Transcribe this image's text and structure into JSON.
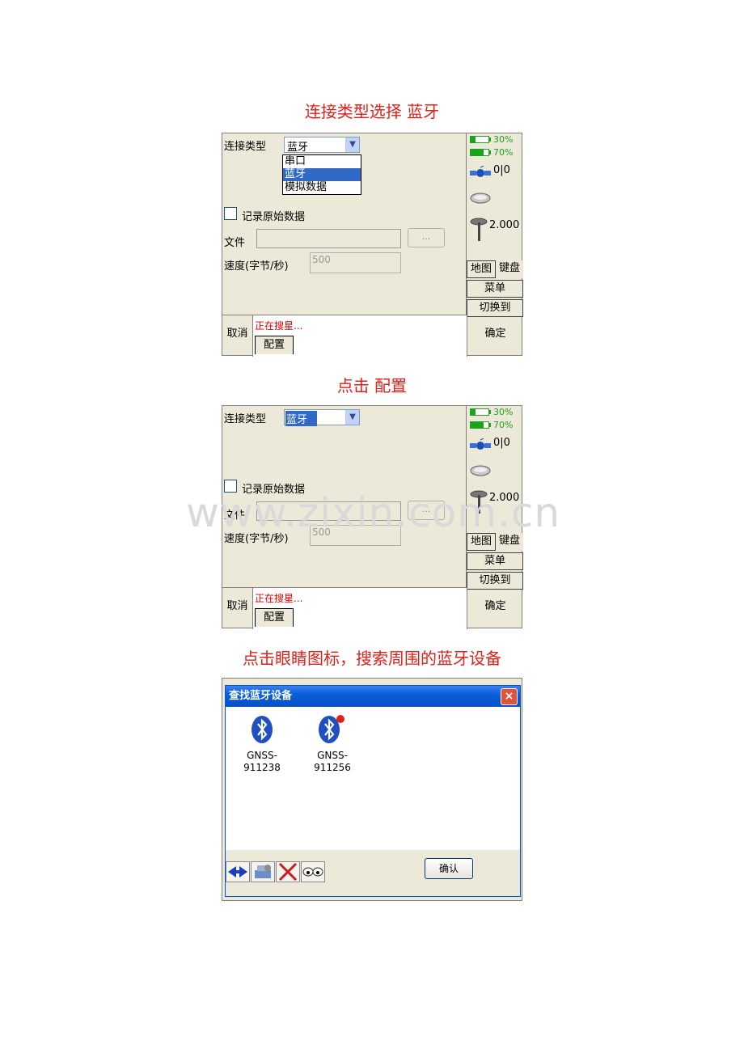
{
  "captions": [
    "连接类型选择    蓝牙",
    "点击  配置",
    "点击眼睛图标，搜索周围的蓝牙设备"
  ],
  "form": {
    "conn_type_label": "连接类型",
    "conn_type_value": "蓝牙",
    "conn_options": [
      "串口",
      "蓝牙",
      "模拟数据"
    ],
    "record_raw_label": "记录原始数据",
    "file_label": "文件",
    "browse_label": "...",
    "speed_label": "速度(字节/秒)",
    "speed_value": "500"
  },
  "status_panel": {
    "battery1": "30%",
    "battery1_level": 0.3,
    "battery2": "70%",
    "battery2_level": 0.7,
    "satellites": "0|0",
    "antenna_height": "2.000",
    "map_button": "地图",
    "keyboard_button": "键盘",
    "menu_button": "菜单",
    "switch_button": "切换到"
  },
  "bottom": {
    "cancel": "取消",
    "status_text": "正在搜星...",
    "config_tab": "配置",
    "ok": "确定"
  },
  "bt_dialog": {
    "title": "查找蓝牙设备",
    "close": "×",
    "devices": [
      {
        "name_line1": "GNSS-",
        "name_line2": "911238",
        "connected": false
      },
      {
        "name_line1": "GNSS-",
        "name_line2": "911256",
        "connected": true
      }
    ],
    "confirm": "确认",
    "tools": [
      "connect-icon",
      "settings-icon",
      "delete-icon",
      "eye-icon"
    ]
  },
  "watermark": "www.zixin.com.cn"
}
